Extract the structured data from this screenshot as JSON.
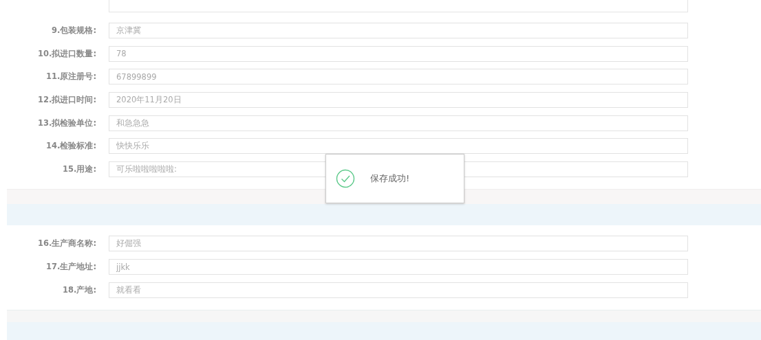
{
  "sections": [
    {
      "fields": [
        {
          "label": "9.包装规格:",
          "value": "京津冀"
        },
        {
          "label": "10.拟进口数量:",
          "value": "78"
        },
        {
          "label": "11.原注册号:",
          "value": "67899899"
        },
        {
          "label": "12.拟进口时间:",
          "value": "2020年11月20日"
        },
        {
          "label": "13.拟检验单位:",
          "value": "和急急急"
        },
        {
          "label": "14.检验标准:",
          "value": "快快乐乐"
        },
        {
          "label": "15.用途:",
          "value": "可乐啦啦啦啦啦:"
        }
      ]
    },
    {
      "fields": [
        {
          "label": "16.生产商名称:",
          "value": "好倔强"
        },
        {
          "label": "17.生产地址:",
          "value": "jjkk"
        },
        {
          "label": "18.产地:",
          "value": "就看看"
        }
      ]
    }
  ],
  "toast": {
    "message": "保存成功!"
  }
}
